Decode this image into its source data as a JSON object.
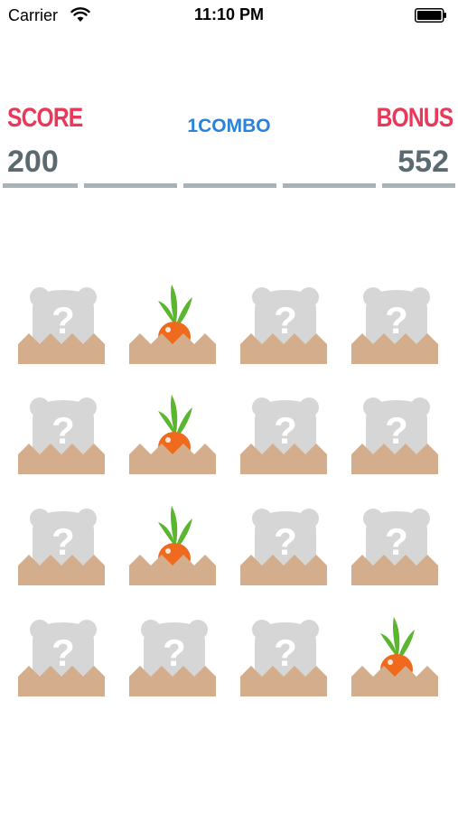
{
  "status_bar": {
    "carrier": "Carrier",
    "time": "11:10 PM"
  },
  "hud": {
    "score_label": "SCORE",
    "score_value": "200",
    "combo_text": "1COMBO",
    "bonus_label": "BONUS",
    "bonus_value": "552",
    "progress_segments_filled": 5,
    "progress_segments_total": 5
  },
  "colors": {
    "label_red": "#e8395a",
    "combo_blue": "#2b82d9",
    "value_gray": "#5a6a70",
    "progress_gray": "#a7b3b7",
    "dirt": "#d4ad8c",
    "mystery_gray": "#d6d6d6",
    "carrot_orange": "#f06a1e",
    "carrot_leaf": "#5ab52f"
  },
  "board": {
    "rows": 4,
    "cols": 4,
    "cells": [
      [
        "mystery",
        "carrot",
        "mystery",
        "mystery"
      ],
      [
        "mystery",
        "carrot",
        "mystery",
        "mystery"
      ],
      [
        "mystery",
        "carrot",
        "mystery",
        "mystery"
      ],
      [
        "mystery",
        "mystery",
        "mystery",
        "carrot"
      ]
    ],
    "mystery_symbol": "?"
  }
}
